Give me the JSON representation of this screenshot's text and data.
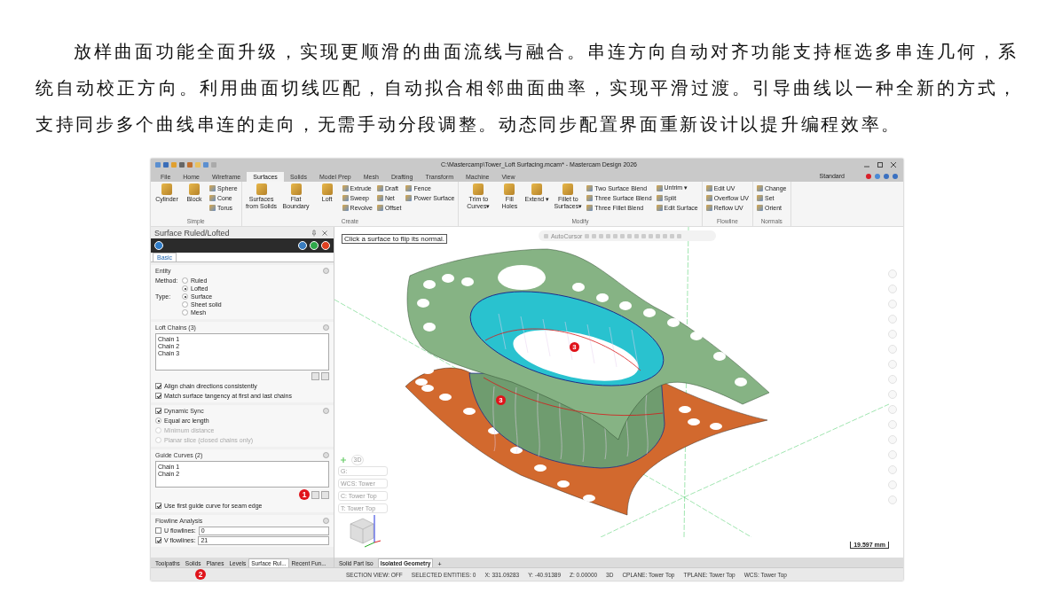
{
  "paragraph": "放样曲面功能全面升级，实现更顺滑的曲面流线与融合。串连方向自动对齐功能支持框选多串连几何，系统自动校正方向。利用曲面切线匹配，自动拟合相邻曲面曲率，实现平滑过渡。引导曲线以一种全新的方式，支持同步多个曲线串连的走向，无需手动分段调整。动态同步配置界面重新设计以提升编程效率。",
  "window": {
    "title": "C:\\Mastercamp\\Tower_Loft Surfacing.mcam* - Mastercam Design 2026",
    "workspace": "Standard"
  },
  "menu_tabs": [
    {
      "label": "File",
      "selected": false
    },
    {
      "label": "Home",
      "selected": false
    },
    {
      "label": "Wireframe",
      "selected": false
    },
    {
      "label": "Surfaces",
      "selected": true
    },
    {
      "label": "Solids",
      "selected": false
    },
    {
      "label": "Model Prep",
      "selected": false
    },
    {
      "label": "Mesh",
      "selected": false
    },
    {
      "label": "Drafting",
      "selected": false
    },
    {
      "label": "Transform",
      "selected": false
    },
    {
      "label": "Machine",
      "selected": false
    },
    {
      "label": "View",
      "selected": false
    }
  ],
  "ribbon_groups": [
    {
      "label": "Simple",
      "items": [
        {
          "kind": "large",
          "label": "Cylinder"
        },
        {
          "kind": "large",
          "label": "Block"
        },
        {
          "kind": "small",
          "label": "Sphere"
        },
        {
          "kind": "small",
          "label": "Cone"
        },
        {
          "kind": "small",
          "label": "Torus"
        }
      ]
    },
    {
      "label": "Create",
      "items": [
        {
          "kind": "large",
          "label": "Surfaces from Solids"
        },
        {
          "kind": "large",
          "label": "Flat Boundary"
        },
        {
          "kind": "large",
          "label": "Loft"
        },
        {
          "kind": "small",
          "label": "Extrude"
        },
        {
          "kind": "small",
          "label": "Sweep"
        },
        {
          "kind": "small",
          "label": "Revolve"
        },
        {
          "kind": "small",
          "label": "Draft"
        },
        {
          "kind": "small",
          "label": "Net"
        },
        {
          "kind": "small",
          "label": "Offset"
        },
        {
          "kind": "small",
          "label": "Fence"
        },
        {
          "kind": "small",
          "label": "Power Surface"
        }
      ]
    },
    {
      "label": "Modify",
      "items": [
        {
          "kind": "large",
          "label": "Trim to Curves▾"
        },
        {
          "kind": "large",
          "label": "Fill Holes"
        },
        {
          "kind": "large",
          "label": "Extend ▾"
        },
        {
          "kind": "large",
          "label": "Fillet to Surfaces▾"
        },
        {
          "kind": "small",
          "label": "Two Surface Blend"
        },
        {
          "kind": "small",
          "label": "Three Surface Blend"
        },
        {
          "kind": "small",
          "label": "Three Fillet Blend"
        },
        {
          "kind": "small",
          "label": "Untrim ▾"
        },
        {
          "kind": "small",
          "label": "Split"
        },
        {
          "kind": "small",
          "label": "Edit Surface"
        }
      ]
    },
    {
      "label": "Flowline",
      "items": [
        {
          "kind": "small",
          "label": "Edit UV"
        },
        {
          "kind": "small",
          "label": "Overflow UV"
        },
        {
          "kind": "small",
          "label": "Reflow UV"
        }
      ]
    },
    {
      "label": "Normals",
      "items": [
        {
          "kind": "small",
          "label": "Change"
        },
        {
          "kind": "small",
          "label": "Set"
        },
        {
          "kind": "small",
          "label": "Orient"
        }
      ]
    }
  ],
  "panel": {
    "title": "Surface Ruled/Lofted",
    "tabs": [
      {
        "label": "Basic",
        "selected": true
      }
    ],
    "entity": {
      "heading": "Entity",
      "method_label": "Method:",
      "methods": [
        {
          "label": "Ruled",
          "selected": false
        },
        {
          "label": "Lofted",
          "selected": true
        }
      ],
      "type_label": "Type:",
      "types": [
        {
          "label": "Surface",
          "selected": true
        },
        {
          "label": "Sheet solid",
          "selected": false
        },
        {
          "label": "Mesh",
          "selected": false
        }
      ]
    },
    "loft_chains": {
      "heading": "Loft Chains (3)",
      "items": [
        "Chain  1",
        "Chain  2",
        "Chain  3"
      ],
      "options": [
        {
          "label": "Align chain directions consistently",
          "checked": true
        },
        {
          "label": "Match surface tangency at first and last chains",
          "checked": true
        }
      ]
    },
    "dynamic_sync": {
      "heading": "Dynamic Sync",
      "checked": true,
      "options": [
        {
          "label": "Equal arc length",
          "selected": true,
          "disabled": false
        },
        {
          "label": "Minimum distance",
          "selected": false,
          "disabled": true
        },
        {
          "label": "Planar slice (closed chains only)",
          "selected": false,
          "disabled": true
        }
      ]
    },
    "guide_curves": {
      "heading": "Guide Curves (2)",
      "items": [
        "Chain  1",
        "Chain  2"
      ],
      "marker": "1",
      "options": [
        {
          "label": "Use first guide curve for seam edge",
          "checked": true
        }
      ]
    },
    "flowline_analysis": {
      "heading": "Flowline Analysis",
      "fields": [
        {
          "label": "U flowlines:",
          "value": "0",
          "checked": false
        },
        {
          "label": "V flowlines:",
          "value": "21",
          "checked": true
        }
      ]
    }
  },
  "panel_tabs": [
    {
      "label": "Toolpaths",
      "selected": false
    },
    {
      "label": "Solids",
      "selected": false
    },
    {
      "label": "Planes",
      "selected": false
    },
    {
      "label": "Levels",
      "selected": false
    },
    {
      "label": "Surface Rul...",
      "selected": true
    },
    {
      "label": "Recent Fun...",
      "selected": false
    }
  ],
  "panel_tabs_marker": "2",
  "viewport": {
    "hint": "Click a surface to flip its normal.",
    "toolbar_label": "AutoCursor",
    "markers": [
      "3",
      "3"
    ],
    "view_mode": "3D",
    "planes": [
      "G:",
      "WCS: Tower",
      "C: Tower Top",
      "T: Tower Top"
    ],
    "scale": "19.597 mm",
    "view_tabs": [
      {
        "label": "Solid Part Iso",
        "selected": false
      },
      {
        "label": "Isolated Geometry",
        "selected": true
      }
    ],
    "add_tab": "+"
  },
  "status_bar": {
    "items": [
      "SECTION VIEW: OFF",
      "SELECTED ENTITIES: 0"
    ],
    "coords": [
      {
        "label": "X:",
        "value": "331.09283"
      },
      {
        "label": "Y:",
        "value": "-40.91389"
      },
      {
        "label": "Z:",
        "value": "0.00000"
      }
    ],
    "mode": "3D",
    "planes": [
      "CPLANE: Tower Top",
      "TPLANE: Tower Top",
      "WCS: Tower Top"
    ]
  }
}
